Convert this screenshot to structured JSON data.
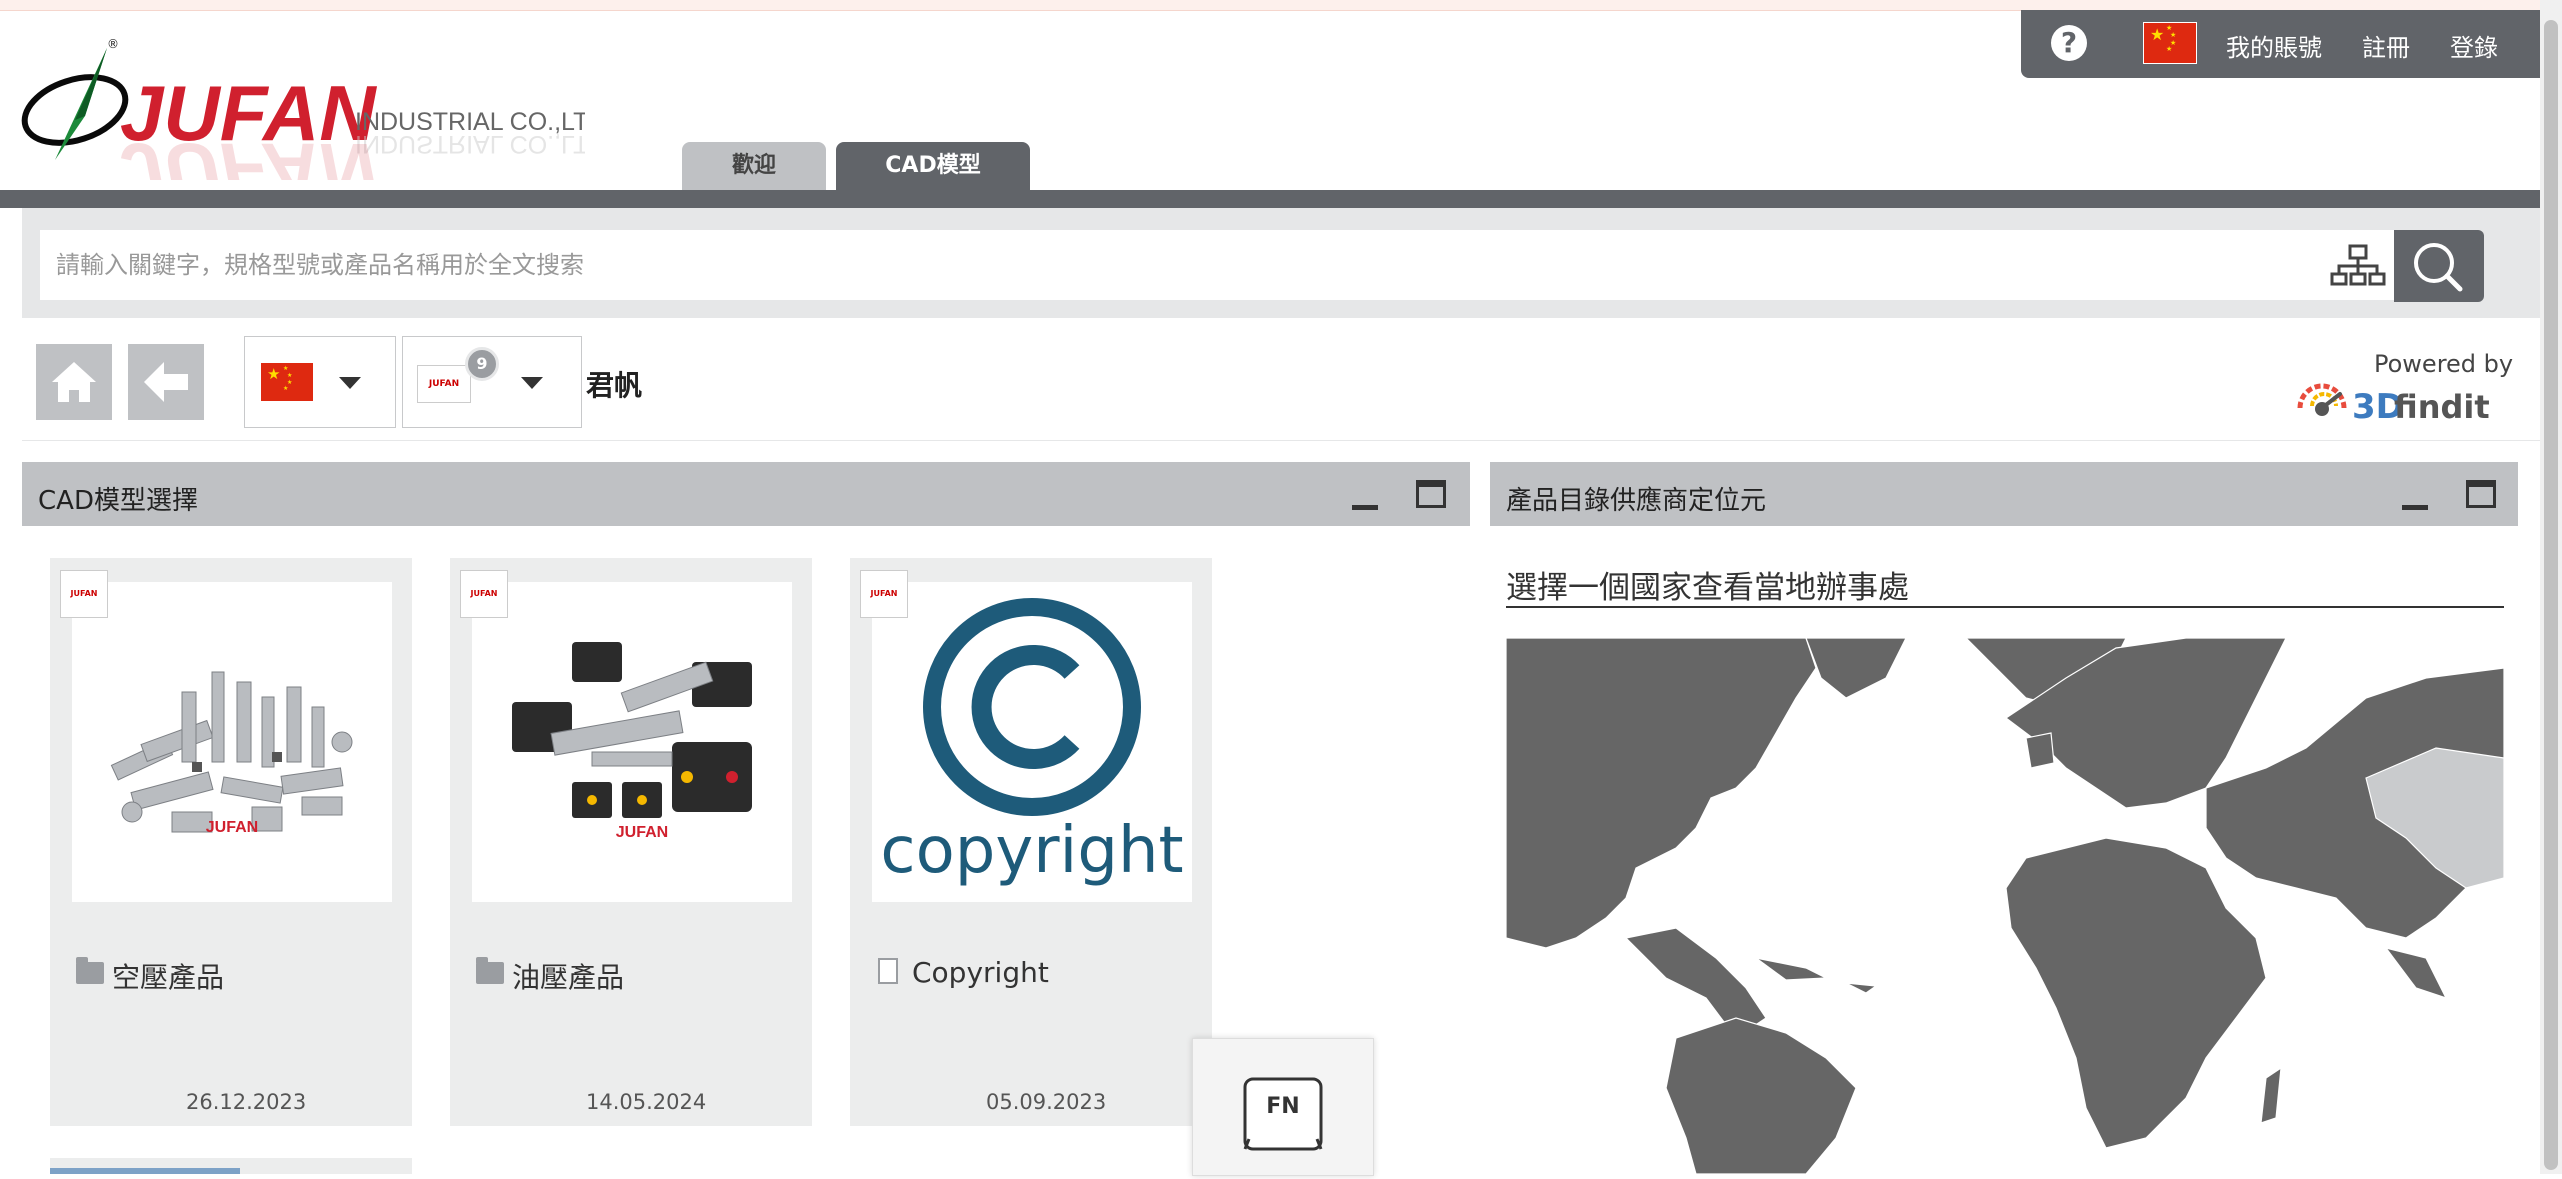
{
  "user_bar": {
    "help": "?",
    "account": "我的賬號",
    "register": "註冊",
    "login": "登錄"
  },
  "logo": {
    "brand": "JUFAN",
    "subtitle": "INDUSTRIAL CO.,LTD.",
    "trademark": "®"
  },
  "tabs": [
    {
      "label": "歡迎",
      "active": false
    },
    {
      "label": "CAD模型",
      "active": true
    }
  ],
  "search": {
    "placeholder": "請輸入關鍵字，規格型號或產品名稱用於全文搜索"
  },
  "toolbar": {
    "supplier_name": "君帆",
    "catalog_badge": "9",
    "catalog_logo_text": "JUFAN",
    "powered_by": "Powered by",
    "findit_brand_3d": "3D",
    "findit_brand_rest": "findit"
  },
  "panels": {
    "left_title": "CAD模型選擇",
    "right_title": "產品目錄供應商定位元"
  },
  "cards": [
    {
      "label": "空壓產品",
      "date": "26.12.2023",
      "icon": "folder-icon",
      "badge": "JUFAN",
      "image_caption": "JUFAN"
    },
    {
      "label": "油壓產品",
      "date": "14.05.2024",
      "icon": "folder-icon",
      "badge": "JUFAN",
      "image_caption": "JUFAN"
    },
    {
      "label": "Copyright",
      "date": "05.09.2023",
      "icon": "document-icon",
      "badge": "JUFAN",
      "image_caption": "copyright"
    }
  ],
  "map": {
    "heading": "選擇一個國家查看當地辦事處"
  },
  "fn_key": {
    "label": "FN"
  },
  "colors": {
    "dark_gray": "#616469",
    "panel_gray": "#bfc1c4",
    "brand_red": "#d0202e",
    "copyright_blue": "#1e5b7a",
    "map_land": "#666666",
    "map_highlight": "#c9cbcd"
  }
}
